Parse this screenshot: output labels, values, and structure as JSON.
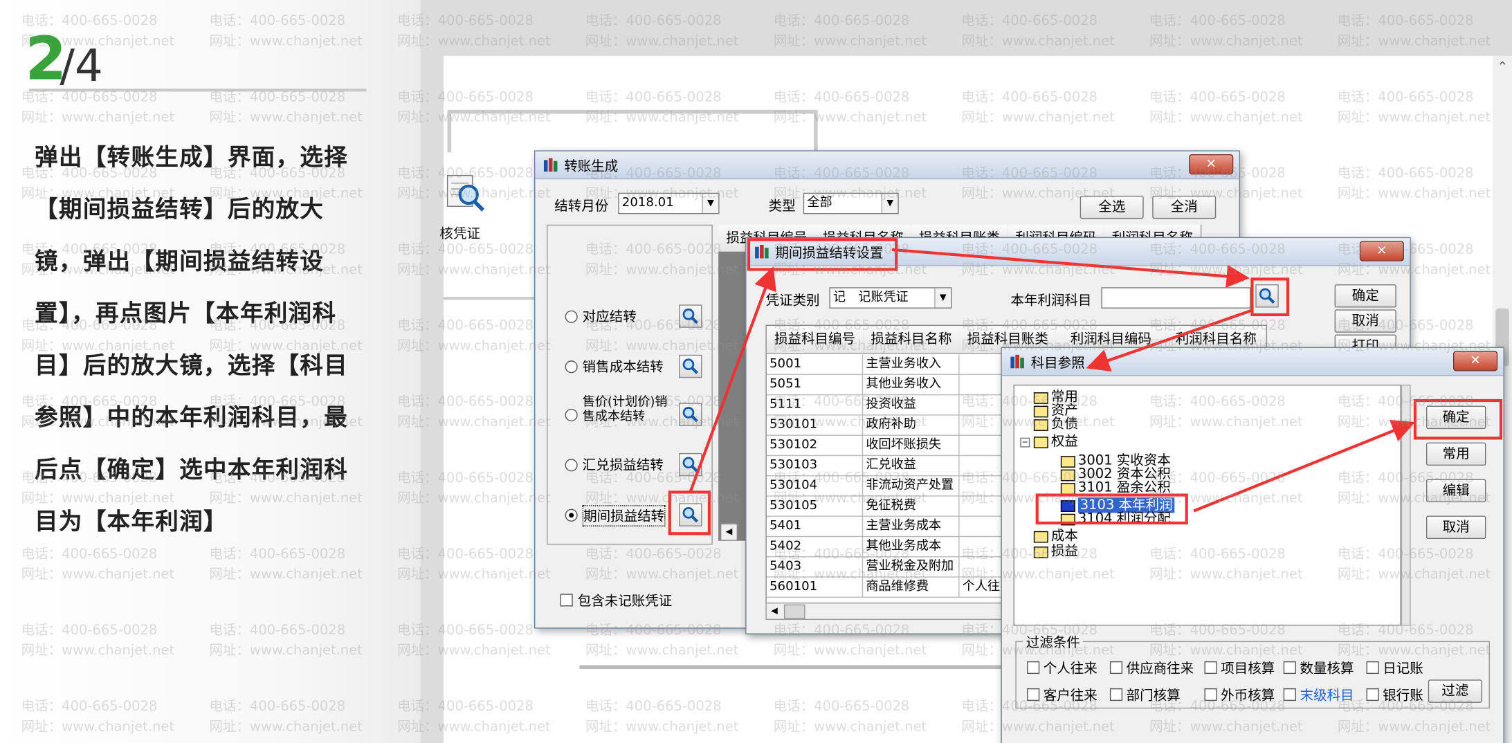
{
  "step": {
    "current": "2",
    "total": "/4"
  },
  "instruction": "弹出【转账生成】界面，选择【期间损益结转】后的放大镜，弹出【期间损益结转设置】，再点图片【本年利润科目】后的放大镜，选择【科目参照】中的本年利润科目，最后点【确定】选中本年利润科目为【本年利润】",
  "watermark": {
    "phone": "电话：400-665-0028",
    "site": "网址：www.chanjet.net"
  },
  "background": {
    "icon_label": "核凭证"
  },
  "transfer_window": {
    "title": "转账生成",
    "month_label": "结转月份",
    "month_value": "2018.01",
    "type_label": "类型",
    "type_value": "全部",
    "select_all": "全选",
    "deselect_all": "全消",
    "options": [
      "对应结转",
      "销售成本结转",
      "售价(计划价)销售成本结转",
      "汇兑损益结转",
      "期间损益结转"
    ],
    "selected_option": "期间损益结转",
    "include_unposted": "包含未记账凭证",
    "column_headers": [
      "损益科目编号",
      "损益科目名称",
      "损益科目账类",
      "利润科目编码",
      "利润科目名称"
    ]
  },
  "settings_window": {
    "title": "期间损益结转设置",
    "voucher_type_label": "凭证类别",
    "voucher_type_value": "记　记账凭证",
    "profit_account_label": "本年利润科目",
    "profit_account_value": "",
    "buttons": {
      "ok": "确定",
      "cancel": "取消",
      "print": "打印"
    },
    "columns": [
      "损益科目编号",
      "损益科目名称",
      "损益科目账类",
      "利润科目编码",
      "利润科目名称"
    ],
    "rows": [
      {
        "code": "5001",
        "name": "主营业务收入",
        "acct": ""
      },
      {
        "code": "5051",
        "name": "其他业务收入",
        "acct": ""
      },
      {
        "code": "5111",
        "name": "投资收益",
        "acct": ""
      },
      {
        "code": "530101",
        "name": "政府补助",
        "acct": ""
      },
      {
        "code": "530102",
        "name": "收回坏账损失",
        "acct": ""
      },
      {
        "code": "530103",
        "name": "汇兑收益",
        "acct": ""
      },
      {
        "code": "530104",
        "name": "非流动资产处置",
        "acct": ""
      },
      {
        "code": "530105",
        "name": "免征税费",
        "acct": ""
      },
      {
        "code": "5401",
        "name": "主营业务成本",
        "acct": ""
      },
      {
        "code": "5402",
        "name": "其他业务成本",
        "acct": ""
      },
      {
        "code": "5403",
        "name": "营业税金及附加",
        "acct": ""
      },
      {
        "code": "560101",
        "name": "商品维修费",
        "acct": "个人往"
      }
    ]
  },
  "ref_window": {
    "title": "科目参照",
    "tree": [
      {
        "label": "常用",
        "level": 0
      },
      {
        "label": "资产",
        "level": 0
      },
      {
        "label": "负债",
        "level": 0
      },
      {
        "label": "权益",
        "level": 0
      },
      {
        "label": "3001  实收资本",
        "level": 1
      },
      {
        "label": "3002  资本公积",
        "level": 1
      },
      {
        "label": "3101  盈余公积",
        "level": 1
      },
      {
        "label": "3103  本年利润",
        "level": 1,
        "selected": true
      },
      {
        "label": "3104  利润分配",
        "level": 1
      },
      {
        "label": "成本",
        "level": 0
      },
      {
        "label": "损益",
        "level": 0
      }
    ],
    "buttons": {
      "ok": "确定",
      "common": "常用",
      "edit": "编辑",
      "cancel": "取消"
    },
    "filter_title": "过滤条件",
    "filters_row1": [
      "个人往来",
      "供应商往来",
      "项目核算",
      "数量核算",
      "日记账"
    ],
    "filters_row2": [
      "客户往来",
      "部门核算",
      "外币核算",
      "末级科目",
      "银行账"
    ],
    "filter_button": "过滤",
    "highlight_color": "#3366cc",
    "link_color": "#1a5fd6"
  },
  "annotation_color": "#ee3333"
}
